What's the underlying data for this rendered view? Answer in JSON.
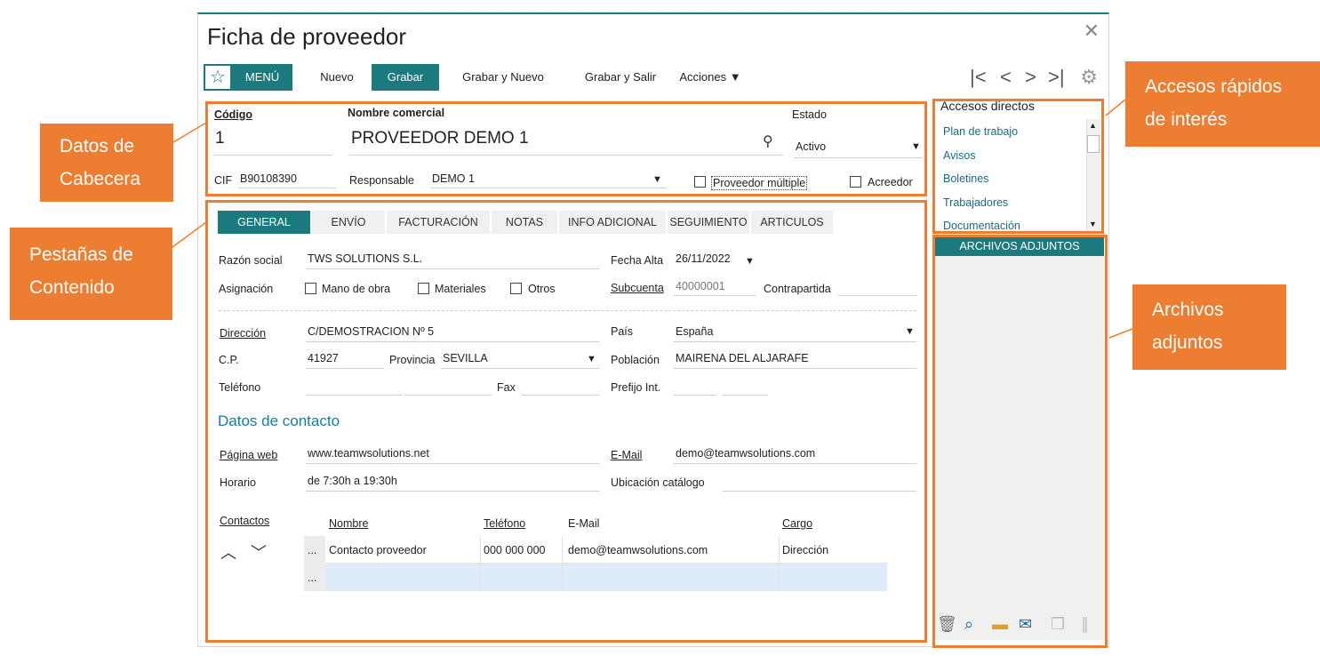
{
  "window": {
    "title": "Ficha de proveedor"
  },
  "toolbar": {
    "menu": "MENÚ",
    "nuevo": "Nuevo",
    "grabar": "Grabar",
    "grabar_nuevo": "Grabar y Nuevo",
    "grabar_salir": "Grabar y Salir",
    "acciones": "Acciones ▼"
  },
  "header": {
    "codigo_label": "Código",
    "codigo_value": "1",
    "nombre_label": "Nombre comercial",
    "nombre_value": "PROVEEDOR DEMO 1",
    "estado_label": "Estado",
    "estado_value": "Activo",
    "cif_label": "CIF",
    "cif_value": "B90108390",
    "responsable_label": "Responsable",
    "responsable_value": "DEMO 1",
    "proveedor_multiple": "Proveedor múltiple",
    "acreedor": "Acreedor"
  },
  "tabs": [
    "GENERAL",
    "ENVÍO",
    "FACTURACIÓN",
    "NOTAS",
    "INFO ADICIONAL",
    "SEGUIMIENTO",
    "ARTICULOS"
  ],
  "general": {
    "razon_label": "Razón social",
    "razon_value": "TWS SOLUTIONS S.L.",
    "fecha_alta_label": "Fecha Alta",
    "fecha_alta_value": "26/11/2022",
    "asignacion_label": "Asignación",
    "mano_obra": "Mano de obra",
    "materiales": "Materiales",
    "otros": "Otros",
    "subcuenta_label": "Subcuenta",
    "subcuenta_value": "40000001",
    "contrapartida_label": "Contrapartida",
    "direccion_label": "Dirección",
    "direccion_value": "C/DEMOSTRACION Nº 5",
    "pais_label": "País",
    "pais_value": "España",
    "cp_label": "C.P.",
    "cp_value": "41927",
    "provincia_label": "Provincia",
    "provincia_value": "SEVILLA",
    "poblacion_label": "Población",
    "poblacion_value": "MAIRENA DEL ALJARAFE",
    "telefono_label": "Teléfono",
    "fax_label": "Fax",
    "prefijo_label": "Prefijo Int."
  },
  "contacto": {
    "section_title": "Datos de contacto",
    "web_label": "Página web",
    "web_value": "www.teamwsolutions.net",
    "email_label": "E-Mail",
    "email_value": "demo@teamwsolutions.com",
    "horario_label": "Horario",
    "horario_value": "de 7:30h a 19:30h",
    "ubicacion_label": "Ubicación catálogo",
    "contactos_label": "Contactos",
    "columns": [
      "Nombre",
      "Teléfono",
      "E-Mail",
      "Cargo"
    ],
    "rows": [
      {
        "marker": "...",
        "nombre": "Contacto proveedor",
        "telefono": "000 000 000",
        "email": "demo@teamwsolutions.com",
        "cargo": "Dirección"
      },
      {
        "marker": "..."
      }
    ]
  },
  "accesos": {
    "title": "Accesos directos",
    "items": [
      "Plan de trabajo",
      "Avisos",
      "Boletines",
      "Trabajadores",
      "Documentación"
    ]
  },
  "adjuntos": {
    "title": "ARCHIVOS ADJUNTOS"
  },
  "callouts": {
    "cabecera": [
      "Datos de",
      "Cabecera"
    ],
    "pestanas": [
      "Pestañas de",
      "Contenido"
    ],
    "accesos": [
      "Accesos rápidos",
      "de interés"
    ],
    "archivos": [
      "Archivos",
      "adjuntos"
    ]
  },
  "colors": {
    "accent": "#1a7a7d",
    "highlight": "#ed7d31",
    "link": "#1a6a8a"
  }
}
